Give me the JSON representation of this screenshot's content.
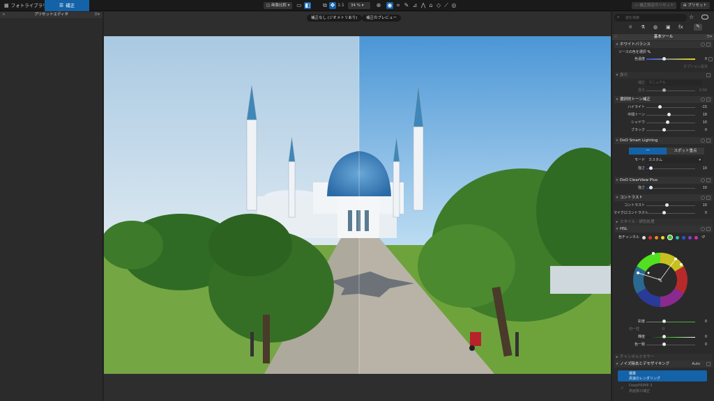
{
  "topbar": {
    "tab_library": "フォトライブラリ",
    "tab_customize": "補正",
    "compare_label": "画像比較",
    "zoom": "34 %",
    "reset_label": "補正設定のリセット",
    "preset_label": "プリセット"
  },
  "left_panel": {
    "title": "プリセットエディタ"
  },
  "viewer": {
    "before_label": "補正なし (ジオメトリあり)",
    "after_label": "補正のプレビュー"
  },
  "right_panel": {
    "search_placeholder": "値を検索",
    "section_title": "基本ツール",
    "white_balance": {
      "title": "ホワイトバランス",
      "picker_label": "ソースの色を選択",
      "temp_label": "色温度",
      "temp_value": "0",
      "note": "オプション設定"
    },
    "exposure": {
      "title": "露光",
      "mode_label": "補正",
      "mode_value": "マニュアル",
      "amount_label": "露光",
      "amount_value": "0.00"
    },
    "selective_tone": {
      "title": "選択的トーン補正",
      "sliders": [
        {
          "label": "ハイライト",
          "value": "-15"
        },
        {
          "label": "中間トーン",
          "value": "18"
        },
        {
          "label": "シャドウ",
          "value": "10"
        },
        {
          "label": "ブラック",
          "value": "0"
        }
      ]
    },
    "smart_lighting": {
      "title": "DxO Smart Lighting",
      "tab_uniform": "一",
      "tab_spot": "スポット重点",
      "mode_label": "モード",
      "mode_value": "カスタム",
      "strength_label": "強さ",
      "strength_value": "10"
    },
    "clearview": {
      "title": "DxO ClearView Plus",
      "strength_label": "強さ",
      "strength_value": "10"
    },
    "contrast": {
      "title": "コントラスト",
      "sliders": [
        {
          "label": "コントラスト",
          "value": "10"
        },
        {
          "label": "マイクロコントラスト",
          "value": "0"
        }
      ]
    },
    "style_title": "スタイル - 調色処理",
    "hsl": {
      "title": "HSL",
      "channel_label": "色チャンネル",
      "saturation_label": "彩度",
      "saturation_value": "0",
      "uniformity_label": "均一性",
      "uniformity_value": "0",
      "luminance_label": "輝度",
      "luminance_value": "0",
      "harmony_label": "色一致",
      "harmony_value": "0"
    },
    "channel_mixer_title": "チャンネルミキサー",
    "denoise": {
      "title": "ノイズ除去とデモザイキング",
      "auto_label": "Auto",
      "item1_title": "標準",
      "item1_sub": "高速のレンダリング",
      "item2_title": "DeepPRIME 3",
      "item2_sub": "高画質の補正"
    }
  },
  "colors": {
    "accent": "#1462a8",
    "panel": "#2a2a2a",
    "section": "#333333"
  }
}
